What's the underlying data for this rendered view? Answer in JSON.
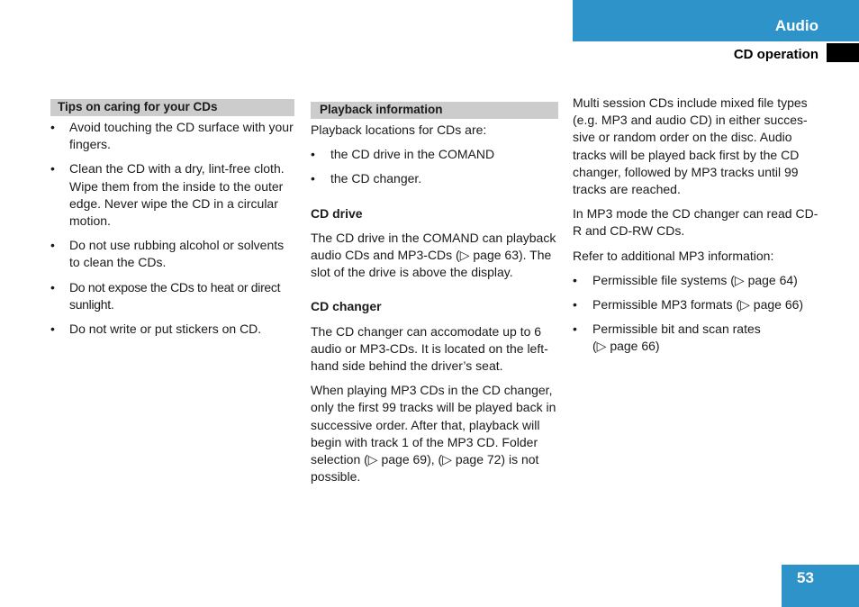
{
  "header": {
    "section_title": "Audio",
    "subsection_title": "CD operation",
    "accent_color": "#2e93c9"
  },
  "col1": {
    "heading": "Tips on caring for your CDs",
    "bullets": [
      "Avoid touching the CD surface with your fingers.",
      "Clean the CD with a dry, lint-free cloth. Wipe them from the inside to the outer edge. Never wipe the CD in a circular motion.",
      "Do not use rubbing alcohol or solvents to clean the CDs.",
      "Do not expose the CDs to heat or direct sunlight.",
      "Do not write or put stickers on CD."
    ]
  },
  "col2": {
    "heading": "Playback information",
    "intro": "Playback locations for CDs are:",
    "bullets": [
      "the CD drive in the COMAND",
      "the CD changer."
    ],
    "cd_drive": {
      "heading": "CD drive",
      "text": "The CD drive in the COMAND can playback audio CDs and MP3-CDs (▷ page 63). The slot of the drive is above the display."
    },
    "cd_changer": {
      "heading": "CD changer",
      "text1": "The CD changer can accomodate up to 6 audio or MP3-CDs. It is located on the left-hand side behind the driver’s seat.",
      "text2": "When playing MP3 CDs in the CD changer, only the first 99 tracks will be played back in successive order. After that, playback will begin with track 1 of the MP3 CD. Folder selection (▷ page 69), (▷ page 72) is not possible."
    }
  },
  "col3": {
    "para1": "Multi session CDs include mixed file types (e.g. MP3 and audio CD) in either succes-sive or random order on the disc. Audio tracks will be played back first by the CD changer, followed by MP3 tracks until 99 tracks are reached.",
    "para2": "In MP3 mode the CD changer can read CD-R and CD-RW CDs.",
    "para3": "Refer to additional MP3 information:",
    "bullets": [
      "Permissible file systems (▷ page 64)",
      "Permissible MP3 formats (▷ page 66)",
      "Permissible bit and scan rates (▷ page 66)"
    ]
  },
  "bullet_glyph": "•",
  "footer": {
    "page_number": "53"
  }
}
